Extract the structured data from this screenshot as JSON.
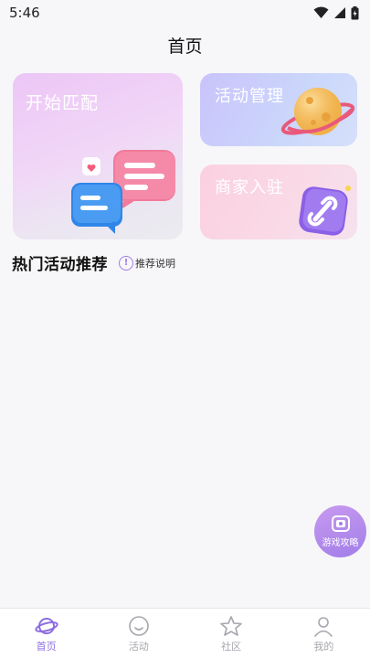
{
  "status_bar": {
    "time": "5:46"
  },
  "header": {
    "title": "首页"
  },
  "cards": {
    "match": {
      "label": "开始匹配"
    },
    "activity": {
      "label": "活动管理"
    },
    "merchant": {
      "label": "商家入驻"
    }
  },
  "section": {
    "title": "热门活动推荐",
    "hint_label": "推荐说明"
  },
  "fab": {
    "label": "游戏攻略"
  },
  "tabs": [
    {
      "label": "首页",
      "active": true
    },
    {
      "label": "活动",
      "active": false
    },
    {
      "label": "社区",
      "active": false
    },
    {
      "label": "我的",
      "active": false
    }
  ],
  "colors": {
    "accent": "#8d6ee0",
    "tab_inactive": "#a6a6ad",
    "page_bg": "#f7f7f9"
  }
}
